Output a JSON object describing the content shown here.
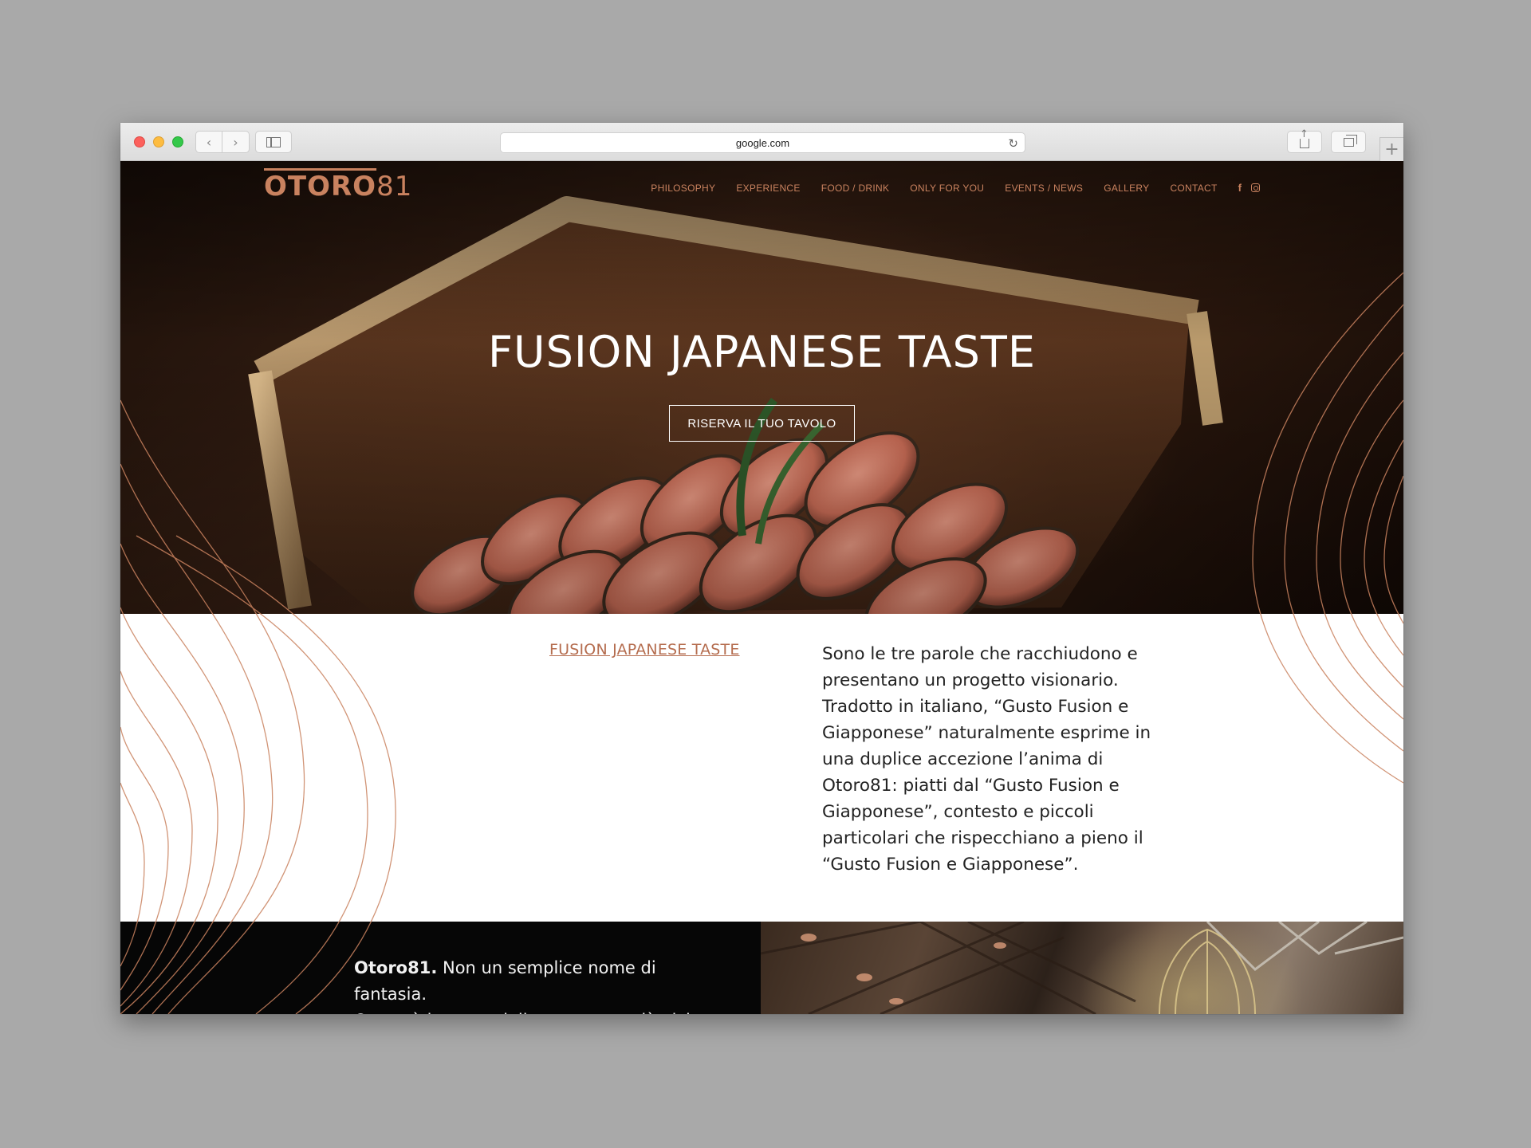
{
  "browser": {
    "url": "google.com"
  },
  "site": {
    "logo_bold": "OTORO",
    "logo_thin": "81",
    "nav": [
      "PHILOSOPHY",
      "EXPERIENCE",
      "FOOD / DRINK",
      "ONLY FOR YOU",
      "EVENTS / NEWS",
      "GALLERY",
      "CONTACT"
    ],
    "social": [
      "facebook-icon",
      "instagram-icon"
    ],
    "facebook_glyph": "f",
    "accent_color": "#c9825f"
  },
  "hero": {
    "title": "FUSION JAPANESE TASTE",
    "cta": "RISERVA IL TUO TAVOLO"
  },
  "intro": {
    "heading": "FUSION JAPANESE TASTE",
    "lines": [
      "Sono le tre parole che racchiudono e",
      "presentano un progetto visionario.",
      "Tradotto in italiano, “Gusto Fusion e",
      "Giapponese” naturalmente esprime in",
      "una duplice accezione l’anima di",
      "Otoro81: piatti dal “Gusto Fusion e",
      "Giapponese”, contesto e piccoli",
      "particolari che rispecchiano a pieno il",
      "“Gusto Fusion e Giapponese”."
    ]
  },
  "story": {
    "bold": "Otoro81.",
    "line1_rest": " Non un semplice nome di fantasia.",
    "line2": "Otoro, è la parte della ventresca più vicina"
  }
}
